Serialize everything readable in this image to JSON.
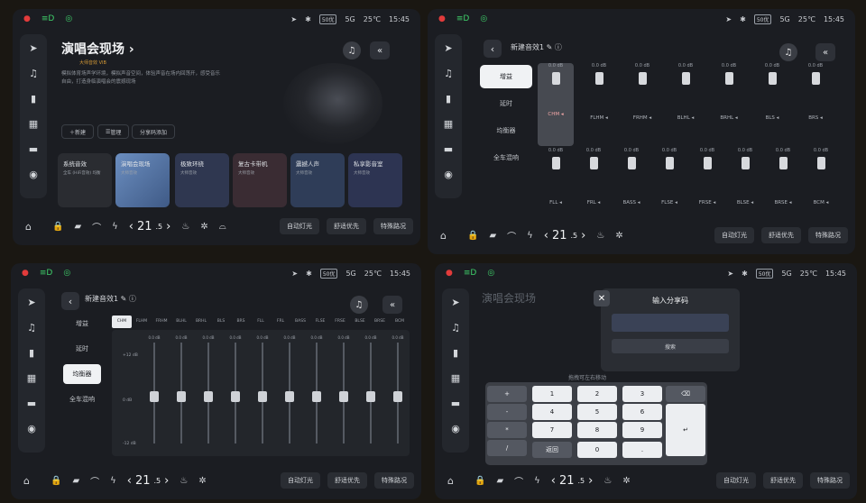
{
  "status": {
    "aqi": "50优",
    "signal": "5G",
    "temp": "25℃",
    "time": "15:45"
  },
  "bottom": {
    "cabin_temp": "21",
    "cabin_temp_dec": ".5",
    "fan_label": "AC",
    "auto_light": "自动灯光",
    "economy": "舒适优先",
    "special_road": "特殊路况"
  },
  "panel1": {
    "title": "演唱会现场",
    "tag": "大师音效 VIB",
    "desc": "模拟体育场声学环境，模拟声音空间，体验声音在场内回荡开，感受音乐自由，打造身临演唱会的震撼现场",
    "pills": [
      "新建",
      "管理",
      "分享码添加"
    ],
    "cards": [
      {
        "title": "系统音效",
        "sub": "全车 (HiFi音效) 均衡",
        "color": "#2a2c31"
      },
      {
        "title": "演唱会现场",
        "sub": "大师音效",
        "color": "#5b7aa8"
      },
      {
        "title": "极致环绕",
        "sub": "大师音效",
        "color": "#2f3750"
      },
      {
        "title": "复古卡带机",
        "sub": "大师音效",
        "color": "#3a2c33"
      },
      {
        "title": "震撼人声",
        "sub": "大师音效",
        "color": "#2f3d58"
      },
      {
        "title": "私享影音室",
        "sub": "大师音效",
        "color": "#2d3452"
      }
    ]
  },
  "panel2": {
    "title": "新建音效1",
    "nav": [
      "增益",
      "延时",
      "均衡器",
      "全车混响"
    ],
    "row1": [
      "CHM",
      "FLHM",
      "FRHM",
      "BLHL",
      "BRHL",
      "BLS",
      "BRS"
    ],
    "row2": [
      "FLL",
      "FRL",
      "BASS",
      "FLSE",
      "FRSE",
      "BLSE",
      "BRSE",
      "BCM"
    ],
    "db": "0.0 dB"
  },
  "panel3": {
    "title": "新建音效1",
    "nav": [
      "增益",
      "延时",
      "均衡器",
      "全车混响"
    ],
    "tabs": [
      "CHM",
      "FLHM",
      "FRHM",
      "BLHL",
      "BRHL",
      "BLS",
      "BRS",
      "FLL",
      "FRL",
      "BASS",
      "FLSE",
      "FRSE",
      "BLSE",
      "BRSE",
      "BCM"
    ],
    "y_top": "+12 dB",
    "y_mid": "0 dB",
    "y_bot": "-12 dB",
    "slider_value": "0.0 dB"
  },
  "panel4": {
    "title": "演唱会现场",
    "dialog_title": "输入分享码",
    "search_label": "搜索",
    "hint": "拖拽可左右移动",
    "keys": {
      "symbols": [
        "+",
        "-",
        "*",
        "/"
      ],
      "digits": [
        "1",
        "2",
        "3",
        "4",
        "5",
        "6",
        "7",
        "8",
        "9",
        "0"
      ],
      "hash": "#",
      "back": "返回",
      "dot": ".",
      "zero": "0",
      "enter": "↵",
      "del": "⌫"
    }
  },
  "colors": {
    "panel_bg": "#1b1d22",
    "accent_red": "#e23b3b",
    "accent_green": "#3fd06a"
  }
}
